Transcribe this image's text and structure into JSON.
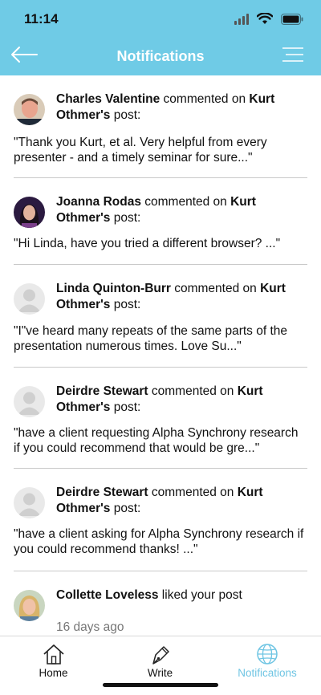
{
  "status_bar": {
    "time": "11:14"
  },
  "header": {
    "title": "Notifications",
    "back_icon": "arrow-left-icon",
    "menu_icon": "menu-icon"
  },
  "colors": {
    "header_bg": "#6fcbe6",
    "accent": "#6fc5e3",
    "divider": "#c9c9c9"
  },
  "notifications": [
    {
      "actor": "Charles Valentine",
      "action": " commented on ",
      "target": "Kurt Othmer's",
      "suffix": " post:",
      "snippet": "\"Thank you Kurt, et al.   Very helpful from every presenter - and a timely seminar for sure...\"",
      "avatar": "photo-man-icon"
    },
    {
      "actor": "Joanna Rodas",
      "action": " commented on ",
      "target": "Kurt Othmer's",
      "suffix": " post:",
      "snippet": "\"Hi Linda, have you tried a different browser? ...\"",
      "avatar": "photo-woman-dark-icon"
    },
    {
      "actor": "Linda Quinton-Burr",
      "action": " commented on ",
      "target": "Kurt Othmer's",
      "suffix": " post:",
      "snippet": "\"I\"ve heard  many  repeats of the same parts of the presentation   numerous times.  Love Su...\"",
      "avatar": "default-avatar-icon"
    },
    {
      "actor": "Deirdre Stewart",
      "action": " commented on ",
      "target": "Kurt Othmer's",
      "suffix": " post:",
      "snippet": "\"have a client requesting Alpha Synchrony research if you could recommend that would be gre...\"",
      "avatar": "default-avatar-icon"
    },
    {
      "actor": "Deirdre Stewart",
      "action": " commented on ",
      "target": "Kurt Othmer's",
      "suffix": " post:",
      "snippet": "\"have a client asking for Alpha Synchrony research if you could recommend thanks! ...\"",
      "avatar": "default-avatar-icon"
    },
    {
      "actor": "Collette Loveless",
      "action": " liked your post",
      "time_ago": "16 days ago",
      "avatar": "photo-woman-blonde-icon"
    }
  ],
  "tabbar": {
    "tabs": [
      {
        "label": "Home",
        "icon": "home-icon",
        "active": false
      },
      {
        "label": "Write",
        "icon": "pen-icon",
        "active": false
      },
      {
        "label": "Notifications",
        "icon": "globe-icon",
        "active": true
      }
    ]
  }
}
